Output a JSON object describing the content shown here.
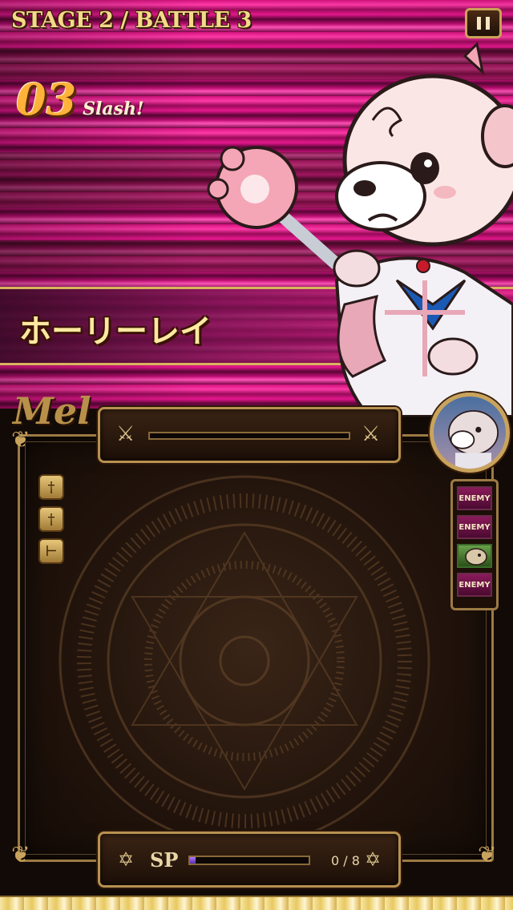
{
  "header": {
    "stage_label": "STAGE 2 / BATTLE  3",
    "pause_icon": "pause-icon"
  },
  "combo": {
    "count": "03",
    "word": "Slash!"
  },
  "skill": {
    "name": "ホーリーレイ"
  },
  "player": {
    "name": "Mel"
  },
  "hp": {
    "left_icon": "crossed-swords-icon",
    "right_icon": "crossed-swords-icon"
  },
  "status_icons": [
    "dagger-icon",
    "dagger-icon",
    "sword-icon"
  ],
  "sp": {
    "label": "SP",
    "value_text": "0 / 8",
    "current": 0,
    "max": 8,
    "fill_fraction": 0.05
  },
  "turn_order": {
    "slots": [
      "ENEMY",
      "ENEMY",
      "",
      "ENEMY"
    ]
  },
  "colors": {
    "banner_magenta": "#d4127e",
    "gold_frame": "#b89150",
    "combo_orange": "#ffb23a",
    "skill_text": "#ffe9a0"
  }
}
